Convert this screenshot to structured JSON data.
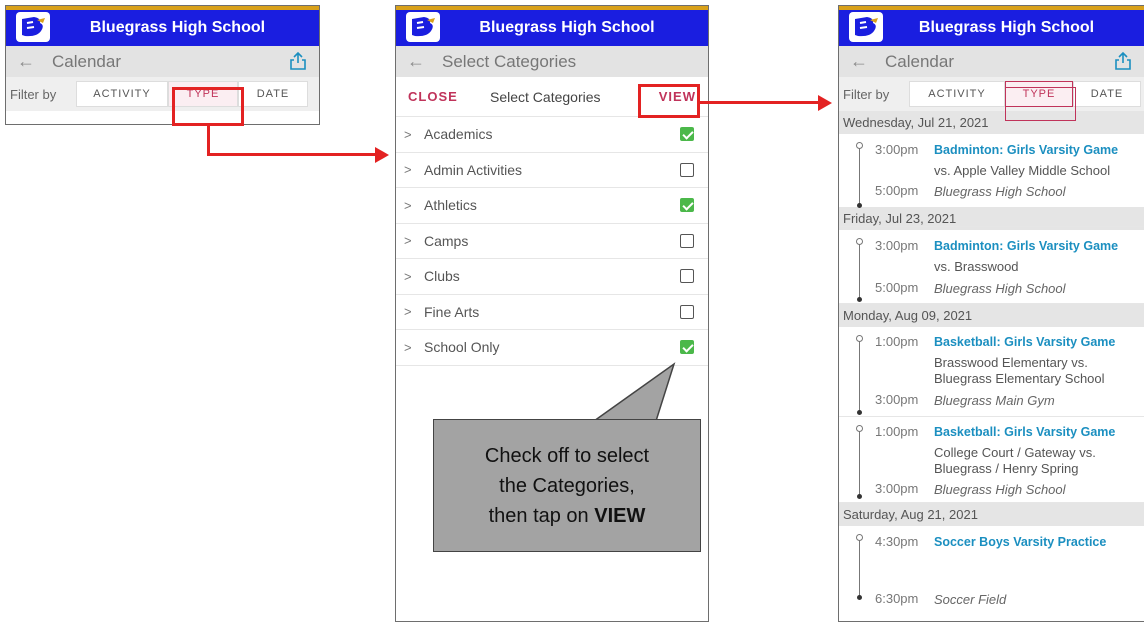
{
  "school_name": "Bluegrass High School",
  "colors": {
    "app_bar": "#1a1ee0",
    "accent": "#c0335a",
    "highlight": "#e32222",
    "link": "#1b8fc0",
    "check": "#4bb84a"
  },
  "panel1": {
    "subbar_title": "Calendar",
    "filter_label": "Filter by",
    "filters": [
      "ACTIVITY",
      "TYPE",
      "DATE"
    ],
    "active_filter": "TYPE"
  },
  "panel2": {
    "subbar_title": "Select Categories",
    "close_label": "CLOSE",
    "title": "Select Categories",
    "view_label": "VIEW",
    "categories": [
      {
        "label": "Academics",
        "checked": true
      },
      {
        "label": "Admin Activities",
        "checked": false
      },
      {
        "label": "Athletics",
        "checked": true
      },
      {
        "label": "Camps",
        "checked": false
      },
      {
        "label": "Clubs",
        "checked": false
      },
      {
        "label": "Fine Arts",
        "checked": false
      },
      {
        "label": "School Only",
        "checked": true
      }
    ]
  },
  "callout": {
    "line1": "Check off to select",
    "line2": "the Categories,",
    "line3": "then tap on",
    "line3_bold": "VIEW"
  },
  "panel3": {
    "subbar_title": "Calendar",
    "filter_label": "Filter by",
    "filters": [
      "ACTIVITY",
      "TYPE",
      "DATE"
    ],
    "groups": [
      {
        "date": "Wednesday, Jul 21, 2021",
        "events": [
          {
            "start": "3:00pm",
            "end": "5:00pm",
            "title": "Badminton: Girls Varsity Game",
            "desc": "vs. Apple Valley Middle School",
            "location": "Bluegrass High School"
          }
        ]
      },
      {
        "date": "Friday, Jul 23, 2021",
        "events": [
          {
            "start": "3:00pm",
            "end": "5:00pm",
            "title": "Badminton: Girls Varsity Game",
            "desc": "vs. Brasswood",
            "location": "Bluegrass High School"
          }
        ]
      },
      {
        "date": "Monday, Aug 09, 2021",
        "events": [
          {
            "start": "1:00pm",
            "end": "3:00pm",
            "title": "Basketball: Girls Varsity Game",
            "desc1": "Brasswood Elementary vs.",
            "desc2": "Bluegrass Elementary School",
            "location": "Bluegrass Main Gym"
          },
          {
            "start": "1:00pm",
            "end": "3:00pm",
            "title": "Basketball: Girls Varsity Game",
            "desc1": "College Court / Gateway vs.",
            "desc2": "Bluegrass / Henry Spring",
            "location": "Bluegrass High School"
          }
        ]
      },
      {
        "date": "Saturday, Aug 21, 2021",
        "events": [
          {
            "start": "4:30pm",
            "end": "6:30pm",
            "title": "Soccer Boys Varsity Practice",
            "location": "Soccer Field"
          }
        ]
      }
    ]
  }
}
